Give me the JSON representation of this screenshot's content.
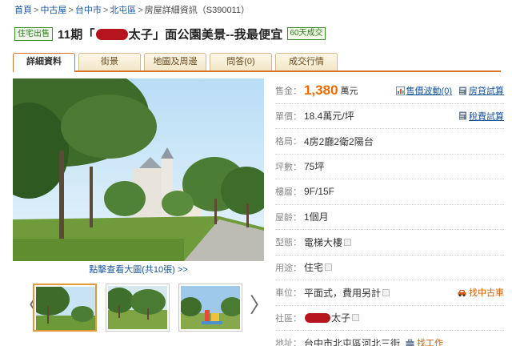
{
  "breadcrumb": [
    "首頁",
    "中古屋",
    "台中市",
    "北屯區",
    "房屋詳細資訊（S390011）"
  ],
  "header": {
    "sale_badge": "住宅出售",
    "title_prefix": "11期「",
    "title_mid": "太子」面公園美景--我最便宜",
    "days_badge": "60天成交"
  },
  "tabs": [
    "詳細資料",
    "街景",
    "地圖及周邊",
    "問答(0)",
    "成交行情"
  ],
  "photo": {
    "caption": "點擊查看大圖(共10張) >>"
  },
  "gallery": {
    "prev": "〈",
    "next": "〉"
  },
  "details": {
    "price": {
      "label": "售金：",
      "value": "1,380",
      "unit": "萬元"
    },
    "price_links": [
      "售價波動(0)",
      "房貸試算"
    ],
    "unit_price": {
      "label": "單價：",
      "value": "18.4萬元/坪"
    },
    "tax_link": "稅費試算",
    "layout": {
      "label": "格局：",
      "value": "4房2廳2衛2陽台"
    },
    "area": {
      "label": "坪數：",
      "value": "75坪"
    },
    "floor": {
      "label": "樓層：",
      "value": "9F/15F"
    },
    "age": {
      "label": "屋齡：",
      "value": "1個月"
    },
    "type": {
      "label": "型態：",
      "value": "電梯大樓"
    },
    "usage": {
      "label": "用途：",
      "value": "住宅"
    },
    "parking": {
      "label": "車位：",
      "value": "平面式，費用另計"
    },
    "parking_link": "找中古車",
    "community": {
      "label": "社區：",
      "value": "太子"
    },
    "address": {
      "label": "地址：",
      "value": "台中市北屯區河北三街"
    },
    "address_link": "找工作"
  },
  "colors": {
    "price": "#ef6b00",
    "link": "#1a56a0",
    "tab_accent": "#d9742a",
    "badge_green": "#2f7a1e"
  }
}
